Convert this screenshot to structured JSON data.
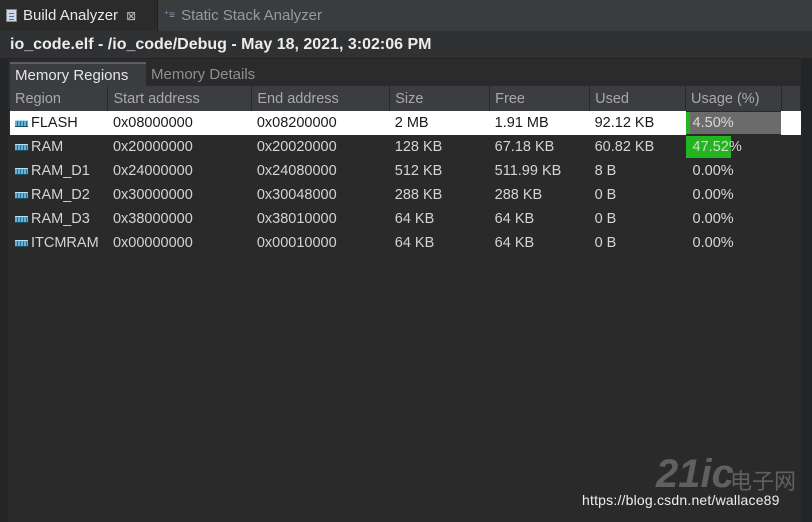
{
  "tabs": {
    "active": {
      "label": "Build Analyzer",
      "close_glyph": "⊠",
      "icon": "document-icon"
    },
    "inactive": {
      "label": "Static Stack Analyzer",
      "icon": "stack-icon"
    }
  },
  "context_line": "io_code.elf - /io_code/Debug - May 18, 2021, 3:02:06 PM",
  "subtabs": [
    {
      "label": "Memory Regions",
      "active": true
    },
    {
      "label": "Memory Details",
      "active": false
    }
  ],
  "columns": [
    "Region",
    "Start address",
    "End address",
    "Size",
    "Free",
    "Used",
    "Usage (%)"
  ],
  "rows": [
    {
      "region": "FLASH",
      "start": "0x08000000",
      "end": "0x08200000",
      "size": "2 MB",
      "free": "1.91 MB",
      "used": "92.12 KB",
      "usage": "4.50%",
      "usage_value": 4.5,
      "selected": true
    },
    {
      "region": "RAM",
      "start": "0x20000000",
      "end": "0x20020000",
      "size": "128 KB",
      "free": "67.18 KB",
      "used": "60.82 KB",
      "usage": "47.52%",
      "usage_value": 47.52,
      "selected": false
    },
    {
      "region": "RAM_D1",
      "start": "0x24000000",
      "end": "0x24080000",
      "size": "512 KB",
      "free": "511.99 KB",
      "used": "8 B",
      "usage": "0.00%",
      "usage_value": 0,
      "selected": false
    },
    {
      "region": "RAM_D2",
      "start": "0x30000000",
      "end": "0x30048000",
      "size": "288 KB",
      "free": "288 KB",
      "used": "0 B",
      "usage": "0.00%",
      "usage_value": 0,
      "selected": false
    },
    {
      "region": "RAM_D3",
      "start": "0x38000000",
      "end": "0x38010000",
      "size": "64 KB",
      "free": "64 KB",
      "used": "0 B",
      "usage": "0.00%",
      "usage_value": 0,
      "selected": false
    },
    {
      "region": "ITCMRAM",
      "start": "0x00000000",
      "end": "0x00010000",
      "size": "64 KB",
      "free": "64 KB",
      "used": "0 B",
      "usage": "0.00%",
      "usage_value": 0,
      "selected": false
    }
  ],
  "colors": {
    "usage_bar": "#22b51f",
    "usage_track": "#6b6b6b",
    "selected_row": "#ffffff"
  },
  "watermark": {
    "url": "https://blog.csdn.net/wallace89",
    "logo_text": "21ic",
    "logo_cn": "电子网"
  }
}
